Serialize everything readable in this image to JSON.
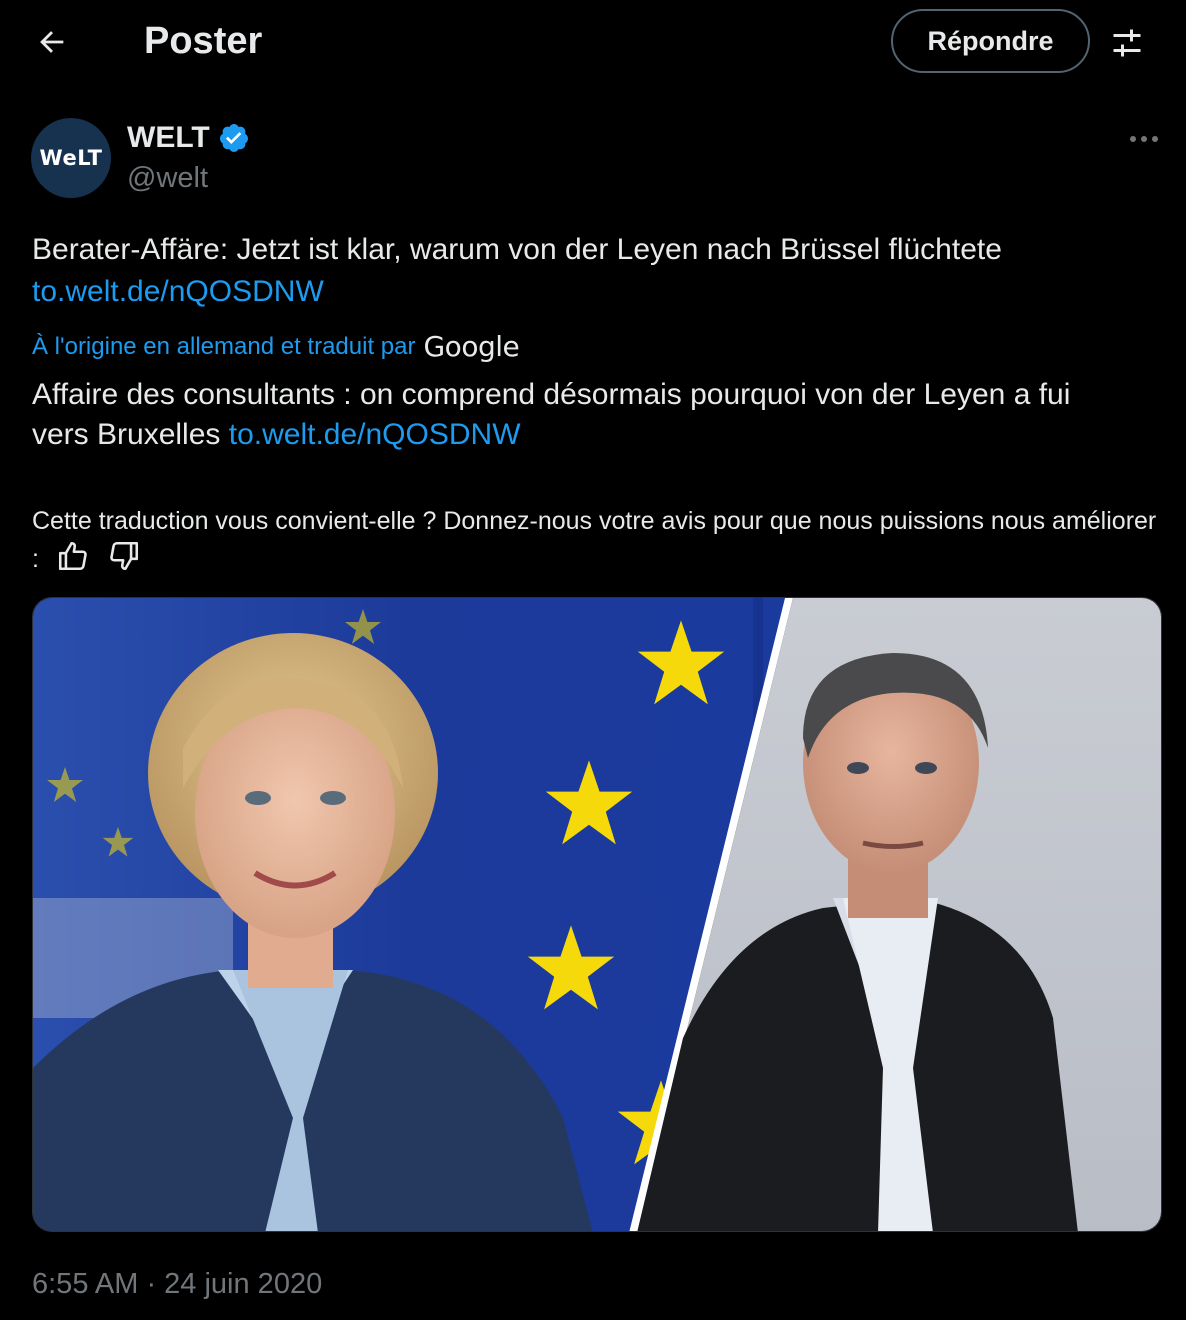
{
  "header": {
    "title": "Poster",
    "reply_label": "Répondre"
  },
  "author": {
    "avatar_text": "WeLT",
    "name": "WELT",
    "handle": "@welt"
  },
  "tweet": {
    "text": "Berater-Affäre: Jetzt ist klar, warum von der Leyen nach Brüssel flüchtete",
    "link": "to.welt.de/nQOSDNW"
  },
  "translation": {
    "by_label": "À l'origine en allemand et traduit par",
    "provider": "Google",
    "text": "Affaire des consultants : on comprend désormais pourquoi von der Leyen a fui vers Bruxelles",
    "link": "to.welt.de/nQOSDNW"
  },
  "feedback": {
    "question": "Cette traduction vous convient-elle ? Donnez-nous votre avis pour que nous puissions nous améliorer :"
  },
  "timestamp": "6:55 AM · 24 juin 2020",
  "colors": {
    "background": "#000000",
    "text": "#e7e9ea",
    "secondary": "#71767b",
    "link": "#1d9bf0",
    "eu_blue": "#1f3fa0",
    "eu_star": "#f5d90a"
  }
}
